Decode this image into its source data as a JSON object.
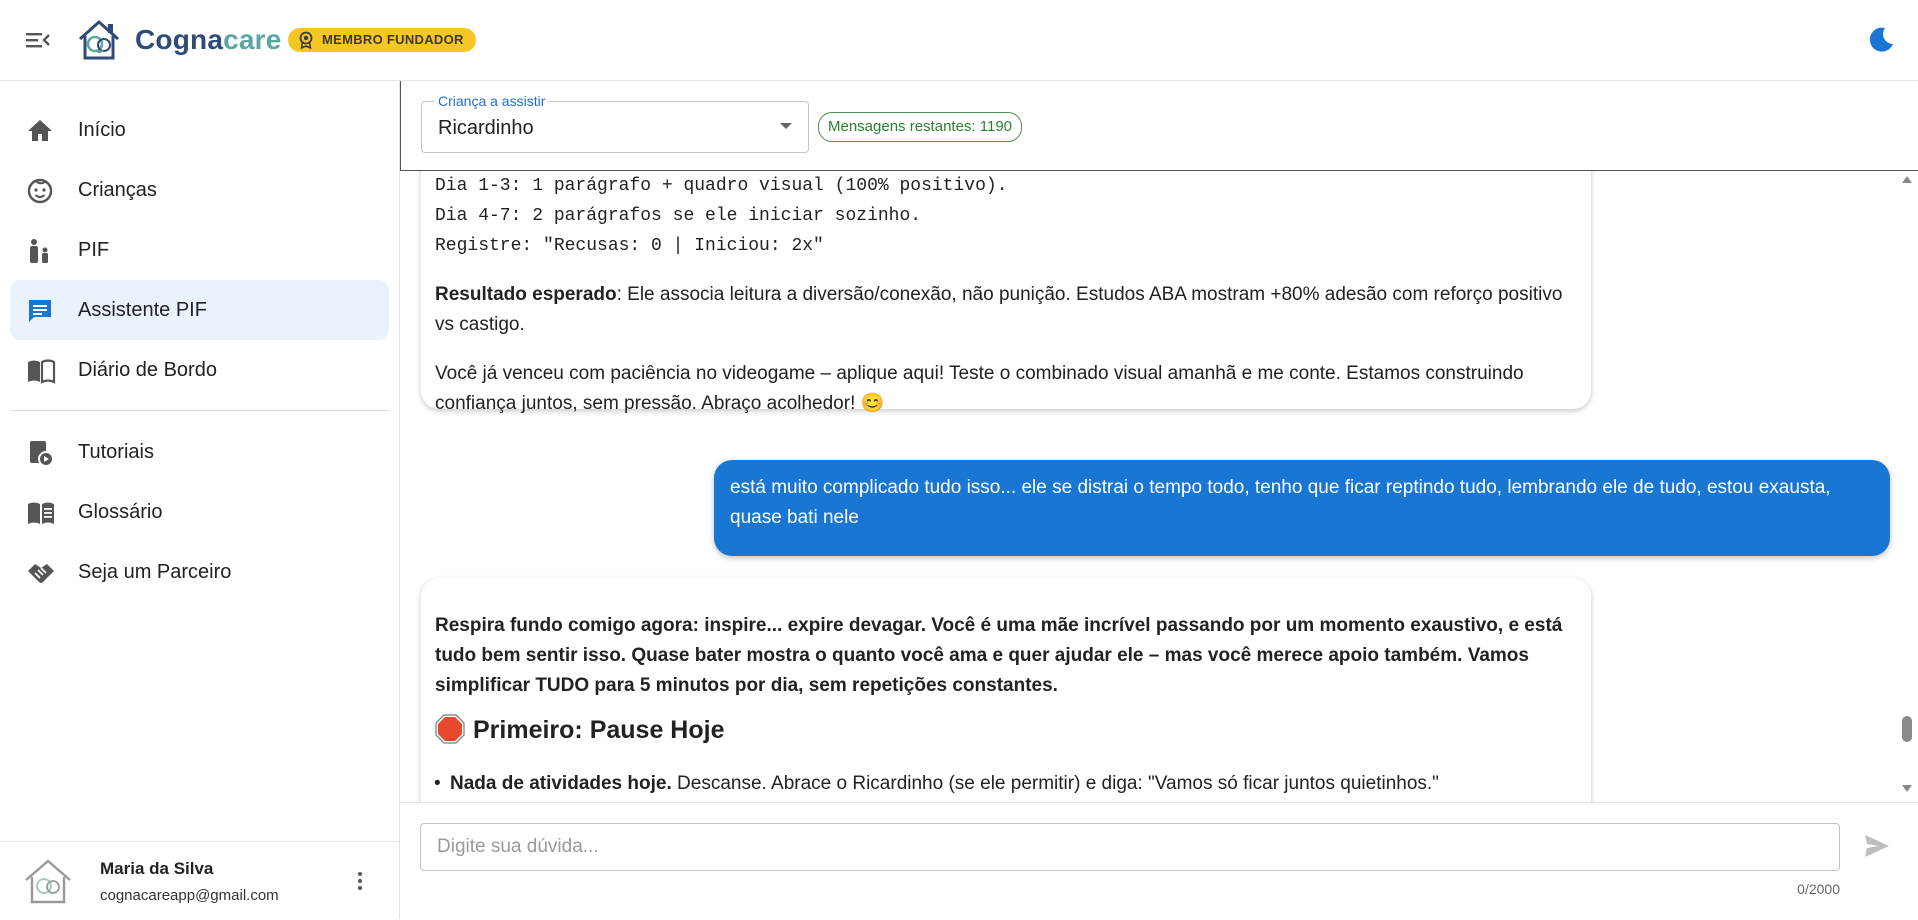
{
  "app": {
    "brand_part1": "Cogna",
    "brand_part2": "care",
    "badge": "MEMBRO FUNDADOR",
    "accent_color": "#1976d2",
    "badge_color": "#f6c623"
  },
  "sidebar": {
    "items": [
      {
        "label": "Início",
        "icon": "home-icon"
      },
      {
        "label": "Crianças",
        "icon": "child-face-icon"
      },
      {
        "label": "PIF",
        "icon": "family-icon"
      },
      {
        "label": "Assistente PIF",
        "icon": "chat-icon",
        "active": true
      },
      {
        "label": "Diário de Bordo",
        "icon": "book-icon"
      },
      {
        "label": "Tutoriais",
        "icon": "video-library-icon"
      },
      {
        "label": "Glossário",
        "icon": "menu-book-icon"
      },
      {
        "label": "Seja um Parceiro",
        "icon": "handshake-icon"
      }
    ],
    "user": {
      "name": "Maria da Silva",
      "email": "cognacareapp@gmail.com"
    }
  },
  "header": {
    "child_select_label": "Criança a assistir",
    "child_select_value": "Ricardinho",
    "messages_remaining": "Mensagens restantes: 1190"
  },
  "chat": {
    "ai1": {
      "code_lines": [
        "Dia 1-3: 1 parágrafo + quadro visual (100% positivo).",
        "Dia 4-7: 2 parágrafos se ele iniciar sozinho.",
        "Registre: \"Recusas: 0 | Iniciou: 2x\""
      ],
      "result_label": "Resultado esperado",
      "result_text": ": Ele associa leitura a diversão/conexão, não punição. Estudos ABA mostram +80% adesão com reforço positivo vs castigo.",
      "closing": "Você já venceu com paciência no videogame – aplique aqui! Teste o combinado visual amanhã e me conte. Estamos construindo confiança juntos, sem pressão. Abraço acolhedor! 😊"
    },
    "user1": {
      "text": "está muito complicado tudo isso... ele se distrai o tempo todo, tenho que ficar reptindo tudo, lembrando ele de tudo, estou exausta, quase bati nele"
    },
    "ai2": {
      "intro": "Respira fundo comigo agora: inspire... expire devagar. Você é uma mãe incrível passando por um momento exaustivo, e está tudo bem sentir isso. Quase bater mostra o quanto você ama e quer ajudar ele – mas você merece apoio também. Vamos simplificar TUDO para 5 minutos por dia, sem repetições constantes.",
      "heading": "Primeiro: Pause Hoje",
      "bullet1_bold": "Nada de atividades hoje.",
      "bullet1_text": " Descanse. Abrace o Ricardinho (se ele permitir) e diga: \"Vamos só ficar juntos quietinhos.\""
    }
  },
  "composer": {
    "placeholder": "Digite sua dúvida...",
    "value": "",
    "counter": "0/2000"
  }
}
